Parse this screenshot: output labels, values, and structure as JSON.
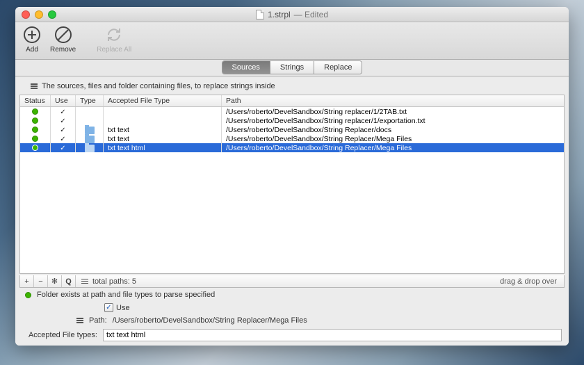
{
  "window": {
    "title": "1.strpl",
    "edited": "— Edited"
  },
  "toolbar": {
    "add": "Add",
    "remove": "Remove",
    "replace_all": "Replace All"
  },
  "tabs": {
    "sources": "Sources",
    "strings": "Strings",
    "replace": "Replace"
  },
  "description": "The sources, files and folder containing files, to replace strings inside",
  "columns": {
    "status": "Status",
    "use": "Use",
    "type": "Type",
    "aft": "Accepted File Type",
    "path": "Path"
  },
  "rows": [
    {
      "status": "ok",
      "use": true,
      "type": "",
      "aft": "",
      "path": "/Users/roberto/DevelSandbox/String replacer/1/2TAB.txt",
      "sel": false
    },
    {
      "status": "ok",
      "use": true,
      "type": "",
      "aft": "",
      "path": "/Users/roberto/DevelSandbox/String replacer/1/exportation.txt",
      "sel": false
    },
    {
      "status": "ok",
      "use": true,
      "type": "folder",
      "aft": "txt text",
      "path": "/Users/roberto/DevelSandbox/String Replacer/docs",
      "sel": false
    },
    {
      "status": "ok",
      "use": true,
      "type": "folder",
      "aft": "txt text",
      "path": "/Users/roberto/DevelSandbox/String Replacer/Mega Files",
      "sel": false
    },
    {
      "status": "ok",
      "use": true,
      "type": "folder",
      "aft": "txt text html",
      "path": "/Users/roberto/DevelSandbox/String Replacer/Mega Files",
      "sel": true
    }
  ],
  "footer": {
    "total": "total paths: 5",
    "drag": "drag & drop over"
  },
  "details": {
    "status_text": "Folder exists at path and file types to parse specified",
    "use_label": "Use",
    "path_label": "Path:",
    "path_value": "/Users/roberto/DevelSandbox/String Replacer/Mega Files",
    "aft_label": "Accepted File types:",
    "aft_value": "txt text html"
  }
}
